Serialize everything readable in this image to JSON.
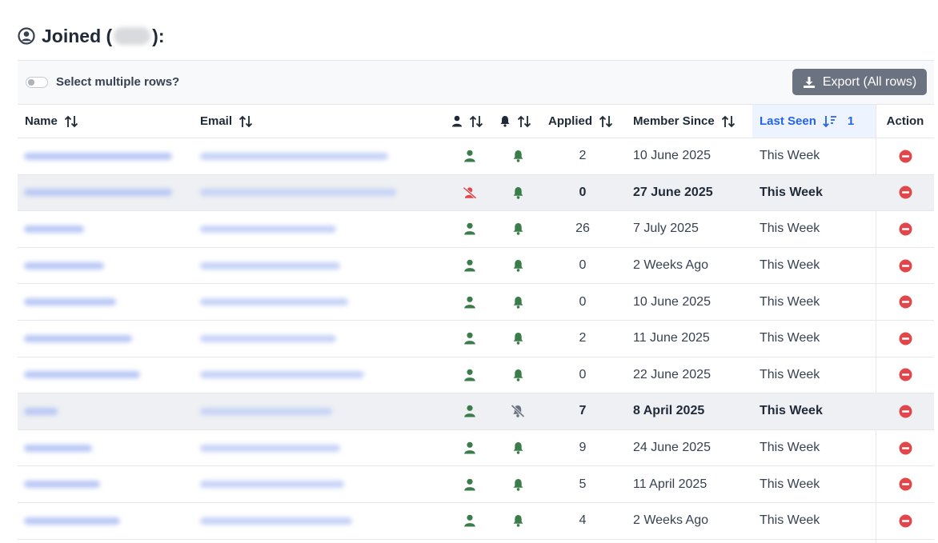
{
  "header": {
    "title_prefix": "Joined (",
    "title_suffix": "):"
  },
  "toolbar": {
    "select_multiple_label": "Select multiple rows?",
    "select_multiple_enabled": false,
    "export_label": "Export (All rows)"
  },
  "columns": {
    "name": "Name",
    "email": "Email",
    "applied": "Applied",
    "member_since": "Member Since",
    "last_seen": "Last Seen",
    "last_seen_sort_order": "1",
    "action": "Action"
  },
  "colors": {
    "green": "#3a7d4a",
    "red": "#e0464a",
    "blue": "#2563eb",
    "grey": "#6b7280"
  },
  "rows": [
    {
      "active": true,
      "notifications": true,
      "applied": "2",
      "member_since": "10 June 2025",
      "last_seen": "This Week",
      "bold": false
    },
    {
      "active": false,
      "notifications": true,
      "applied": "0",
      "member_since": "27 June 2025",
      "last_seen": "This Week",
      "bold": true
    },
    {
      "active": true,
      "notifications": true,
      "applied": "26",
      "member_since": "7 July 2025",
      "last_seen": "This Week",
      "bold": false
    },
    {
      "active": true,
      "notifications": true,
      "applied": "0",
      "member_since": "2 Weeks Ago",
      "last_seen": "This Week",
      "bold": false
    },
    {
      "active": true,
      "notifications": true,
      "applied": "0",
      "member_since": "10 June 2025",
      "last_seen": "This Week",
      "bold": false
    },
    {
      "active": true,
      "notifications": true,
      "applied": "2",
      "member_since": "11 June 2025",
      "last_seen": "This Week",
      "bold": false
    },
    {
      "active": true,
      "notifications": true,
      "applied": "0",
      "member_since": "22 June 2025",
      "last_seen": "This Week",
      "bold": false
    },
    {
      "active": true,
      "notifications": false,
      "applied": "7",
      "member_since": "8 April 2025",
      "last_seen": "This Week",
      "bold": true
    },
    {
      "active": true,
      "notifications": true,
      "applied": "9",
      "member_since": "24 June 2025",
      "last_seen": "This Week",
      "bold": false
    },
    {
      "active": true,
      "notifications": true,
      "applied": "5",
      "member_since": "11 April 2025",
      "last_seen": "This Week",
      "bold": false
    },
    {
      "active": true,
      "notifications": true,
      "applied": "4",
      "member_since": "2 Weeks Ago",
      "last_seen": "This Week",
      "bold": false
    }
  ]
}
